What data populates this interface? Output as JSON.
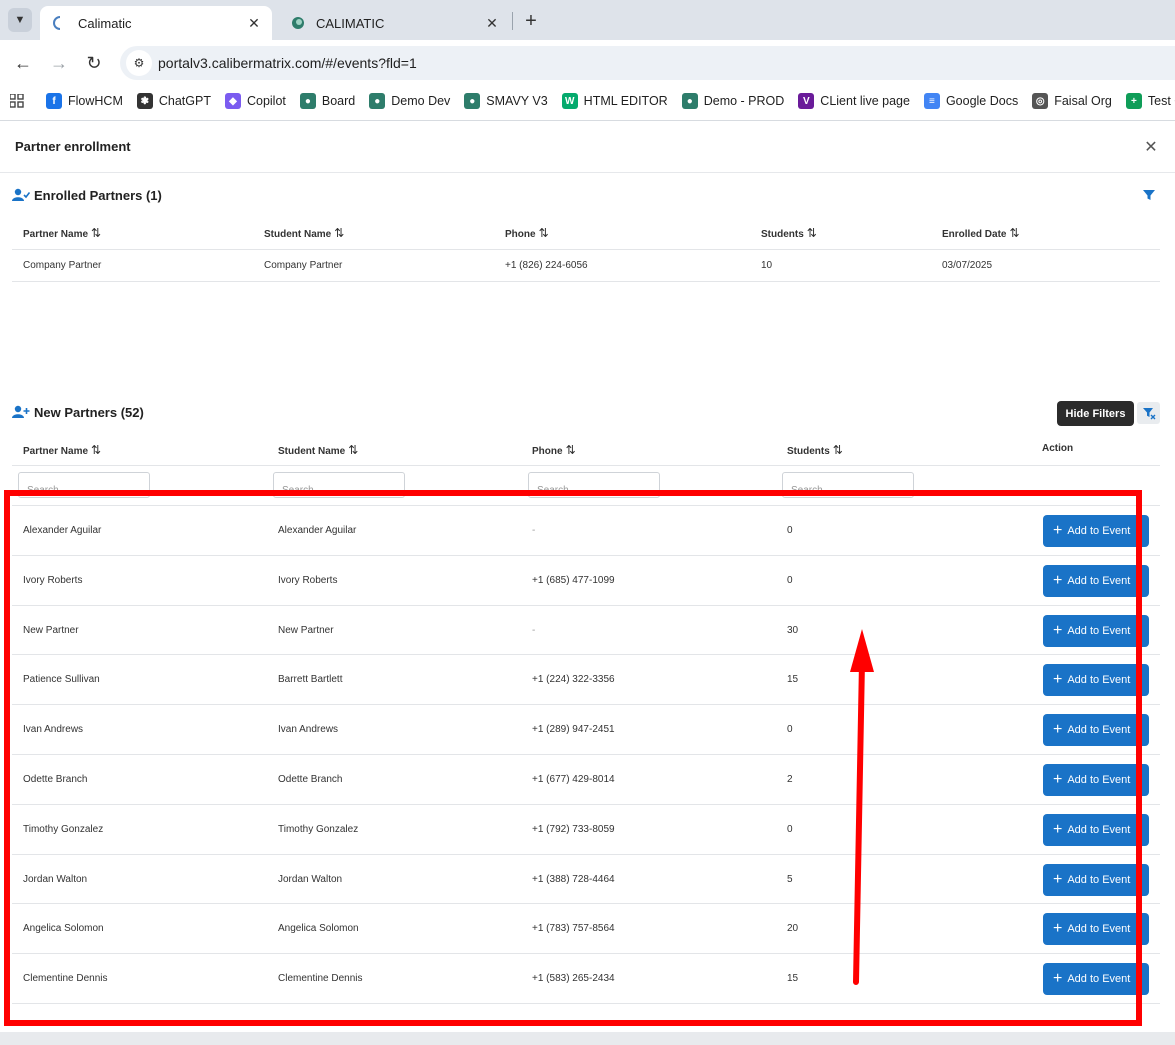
{
  "browser": {
    "tabs": [
      {
        "title": "Calimatic",
        "active": true
      },
      {
        "title": "CALIMATIC",
        "active": false
      }
    ],
    "url": "portalv3.calibermatrix.com/#/events?fld=1",
    "bookmarks": [
      {
        "label": "FlowHCM",
        "icon": "flowhcm-icon",
        "color": "#1a73e8"
      },
      {
        "label": "ChatGPT",
        "icon": "chatgpt-icon",
        "color": "#333333"
      },
      {
        "label": "Copilot",
        "icon": "copilot-icon",
        "color": "#7b5cf0"
      },
      {
        "label": "Board",
        "icon": "calimatic-icon",
        "color": "#2e7d6b"
      },
      {
        "label": "Demo Dev",
        "icon": "calimatic-icon",
        "color": "#2e7d6b"
      },
      {
        "label": "SMAVY V3",
        "icon": "calimatic-icon",
        "color": "#2e7d6b"
      },
      {
        "label": "HTML EDITOR",
        "icon": "w3-icon",
        "color": "#04aa6d"
      },
      {
        "label": "Demo - PROD",
        "icon": "calimatic-icon",
        "color": "#2e7d6b"
      },
      {
        "label": "CLient live page",
        "icon": "v-logo-icon",
        "color": "#6a1b9a"
      },
      {
        "label": "Google Docs",
        "icon": "google-docs-icon",
        "color": "#4285f4"
      },
      {
        "label": "Faisal Org",
        "icon": "globe-icon",
        "color": "#555555"
      },
      {
        "label": "Test Cas",
        "icon": "google-sheets-icon",
        "color": "#0f9d58"
      }
    ]
  },
  "modal": {
    "title": "Partner enrollment"
  },
  "enrolled": {
    "heading": "Enrolled Partners (1)",
    "columns": [
      "Partner Name",
      "Student Name",
      "Phone",
      "Students",
      "Enrolled Date"
    ],
    "rows": [
      {
        "partner": "Company Partner",
        "student": "Company Partner",
        "phone": "+1 (826) 224-6056",
        "students": "10",
        "date": "03/07/2025"
      }
    ]
  },
  "new_partners": {
    "heading": "New Partners (52)",
    "hide_filters_label": "Hide Filters",
    "columns": [
      "Partner Name",
      "Student Name",
      "Phone",
      "Students",
      "Action"
    ],
    "search_placeholder": "Search",
    "action_label": "Add to Event",
    "rows": [
      {
        "partner": "Alexander Aguilar",
        "student": "Alexander Aguilar",
        "phone": "-",
        "students": "0"
      },
      {
        "partner": "Ivory Roberts",
        "student": "Ivory Roberts",
        "phone": "+1 (685) 477-1099",
        "students": "0"
      },
      {
        "partner": "New Partner",
        "student": "New Partner",
        "phone": "-",
        "students": "30"
      },
      {
        "partner": "Patience Sullivan",
        "student": "Barrett Bartlett",
        "phone": "+1 (224) 322-3356",
        "students": "15"
      },
      {
        "partner": "Ivan Andrews",
        "student": "Ivan Andrews",
        "phone": "+1 (289) 947-2451",
        "students": "0"
      },
      {
        "partner": "Odette Branch",
        "student": "Odette Branch",
        "phone": "+1 (677) 429-8014",
        "students": "2"
      },
      {
        "partner": "Timothy Gonzalez",
        "student": "Timothy Gonzalez",
        "phone": "+1 (792) 733-8059",
        "students": "0"
      },
      {
        "partner": "Jordan Walton",
        "student": "Jordan Walton",
        "phone": "+1 (388) 728-4464",
        "students": "5"
      },
      {
        "partner": "Angelica Solomon",
        "student": "Angelica Solomon",
        "phone": "+1 (783) 757-8564",
        "students": "20"
      },
      {
        "partner": "Clementine Dennis",
        "student": "Clementine Dennis",
        "phone": "+1 (583) 265-2434",
        "students": "15"
      }
    ]
  },
  "colors": {
    "primary_button": "#1a73c7",
    "annotation": "#ff0000",
    "tooltip_bg": "#2b2b2b"
  }
}
